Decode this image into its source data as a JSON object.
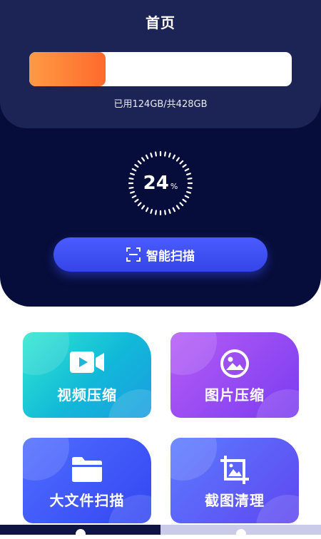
{
  "header": {
    "title": "首页"
  },
  "storage": {
    "used_fraction": 0.29,
    "text": "已用124GB/共428GB"
  },
  "gauge": {
    "value": "24",
    "unit": "%"
  },
  "scan_button": {
    "label": "智能扫描"
  },
  "features": [
    {
      "label": "视频压缩",
      "icon": "video-camera-icon"
    },
    {
      "label": "图片压缩",
      "icon": "image-icon"
    },
    {
      "label": "大文件扫描",
      "icon": "folder-icon"
    },
    {
      "label": "截图清理",
      "icon": "crop-image-icon"
    }
  ],
  "colors": {
    "hero_dark": "#070d3a",
    "hero_panel": "#1c2456",
    "accent_blue": "#3d50f5",
    "progress_orange": "#ff7a30"
  }
}
